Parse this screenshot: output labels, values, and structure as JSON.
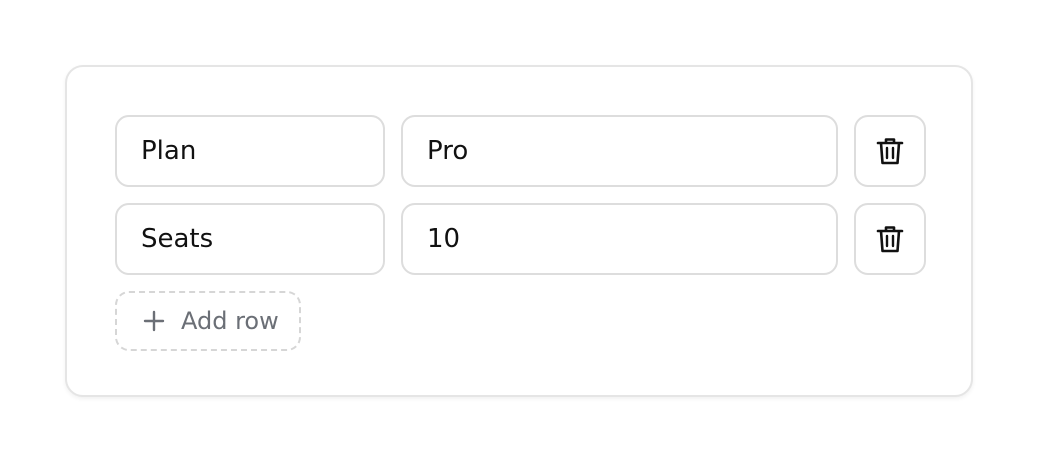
{
  "rows": [
    {
      "key": "Plan",
      "value": "Pro",
      "delete_icon": "trash-icon"
    },
    {
      "key": "Seats",
      "value": "10",
      "delete_icon": "trash-icon"
    }
  ],
  "add_row": {
    "label": "Add row",
    "icon": "plus-icon"
  },
  "colors": {
    "border": "#dddddd",
    "text": "#111111",
    "muted_text": "#6b6f76",
    "dashed_border": "#d6d6d6"
  }
}
